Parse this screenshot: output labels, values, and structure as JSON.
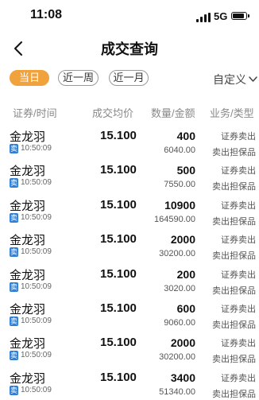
{
  "status": {
    "time": "11:08",
    "network": "5G"
  },
  "nav": {
    "title": "成交查询"
  },
  "filters": {
    "today": "当日",
    "week": "近一周",
    "month": "近一月",
    "custom": "自定义"
  },
  "columns": {
    "security_time": "证券/时间",
    "avg_price": "成交均价",
    "qty_amount": "数量/金额",
    "business_type": "业务/类型"
  },
  "rows": [
    {
      "name": "金龙羽",
      "tag": "卖",
      "time": "10:50:09",
      "price": "15.100",
      "qty": "400",
      "amount": "6040.00",
      "business": "证券卖出",
      "type": "卖出担保品"
    },
    {
      "name": "金龙羽",
      "tag": "卖",
      "time": "10:50:09",
      "price": "15.100",
      "qty": "500",
      "amount": "7550.00",
      "business": "证券卖出",
      "type": "卖出担保品"
    },
    {
      "name": "金龙羽",
      "tag": "卖",
      "time": "10:50:09",
      "price": "15.100",
      "qty": "10900",
      "amount": "164590.00",
      "business": "证券卖出",
      "type": "卖出担保品"
    },
    {
      "name": "金龙羽",
      "tag": "卖",
      "time": "10:50:09",
      "price": "15.100",
      "qty": "2000",
      "amount": "30200.00",
      "business": "证券卖出",
      "type": "卖出担保品"
    },
    {
      "name": "金龙羽",
      "tag": "卖",
      "time": "10:50:09",
      "price": "15.100",
      "qty": "200",
      "amount": "3020.00",
      "business": "证券卖出",
      "type": "卖出担保品"
    },
    {
      "name": "金龙羽",
      "tag": "卖",
      "time": "10:50:09",
      "price": "15.100",
      "qty": "600",
      "amount": "9060.00",
      "business": "证券卖出",
      "type": "卖出担保品"
    },
    {
      "name": "金龙羽",
      "tag": "卖",
      "time": "10:50:09",
      "price": "15.100",
      "qty": "2000",
      "amount": "30200.00",
      "business": "证券卖出",
      "type": "卖出担保品"
    },
    {
      "name": "金龙羽",
      "tag": "卖",
      "time": "10:50:09",
      "price": "15.100",
      "qty": "3400",
      "amount": "51340.00",
      "business": "证券卖出",
      "type": "卖出担保品"
    }
  ]
}
